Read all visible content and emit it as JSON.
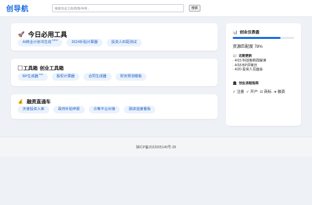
{
  "header": {
    "logo": "创导航",
    "search_placeholder": "搜索创业工具/政策/导师...",
    "search_button": "搜索"
  },
  "sections": [
    {
      "emoji": "🚀",
      "title": "今日必用工具",
      "chips": [
        {
          "label": "AI商业计划书生成",
          "badge": "NEW"
        },
        {
          "label": "2024补贴计算器"
        },
        {
          "label": "投资人匹配测试"
        }
      ]
    },
    {
      "image_alt": "工具箱",
      "title": "创业工具箱",
      "chips": [
        {
          "label": "BP生成器",
          "badge": "Hot"
        },
        {
          "label": "股权计算器"
        },
        {
          "label": "合同生成器"
        },
        {
          "label": "财务预测模板"
        }
      ]
    },
    {
      "emoji": "💰",
      "title": "融资直通车",
      "chips": [
        {
          "label": "天使投资人库"
        },
        {
          "label": "政府补贴申报"
        },
        {
          "label": "众筹平台对接"
        },
        {
          "label": "融资进度看板"
        }
      ]
    }
  ],
  "sidebar": {
    "dashboard_icon": "📊",
    "dashboard_title": "创业仪表盘",
    "progress_value": 0.78,
    "progress_text": "资源匹配度 78%",
    "news_icon": "📰",
    "news_title": "近期更新",
    "news": [
      "· 4/15 科创板新政解读",
      "· 4/18 BP评审日",
      "· 4/20 投资人见面会"
    ],
    "steps_icon": "🏛",
    "steps_title": "创业流程指南",
    "steps": [
      "✓ 注册",
      "✓ 开户",
      "☑ 商标",
      "➜ 融资"
    ]
  },
  "footer": {
    "icp": "陕ICP备2022005149号-28"
  }
}
